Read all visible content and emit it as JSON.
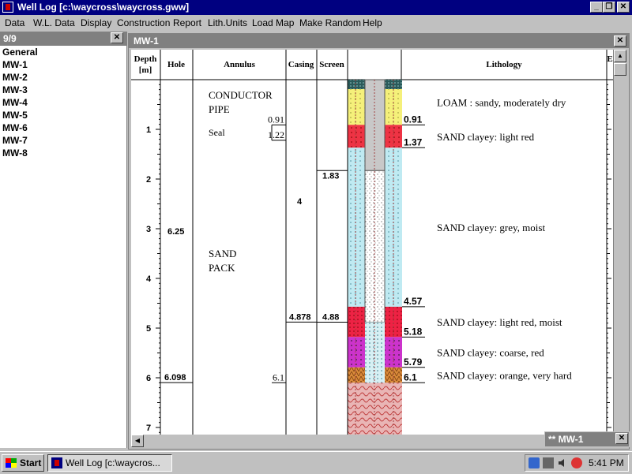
{
  "window": {
    "title": "Well Log [c:\\waycross\\waycross.gww]"
  },
  "menu": [
    "Data",
    "W.L. Data",
    "Display",
    "Construction",
    "Report",
    "Lith.Units",
    "Load Map",
    "Make Random",
    "Help"
  ],
  "left_panel": {
    "header": "9/9",
    "items": [
      "General",
      "MW-1",
      "MW-2",
      "MW-3",
      "MW-4",
      "MW-5",
      "MW-6",
      "MW-7",
      "MW-8"
    ]
  },
  "log_window": {
    "title": "MW-1",
    "columns": {
      "depth": "Depth [m]",
      "hole": "Hole",
      "annulus": "Annulus",
      "casing": "Casing",
      "screen": "Screen",
      "lithology": "Lithology",
      "extra": "E"
    },
    "depth_ticks": [
      "1",
      "2",
      "3",
      "4",
      "5",
      "6",
      "7"
    ],
    "hole": {
      "diameter": "6.25",
      "bottom": "6.098"
    },
    "annulus": {
      "conductor_line1": "CONDUCTOR",
      "conductor_line2": "PIPE",
      "conductor_bottom": "0.91",
      "seal_label": "Seal",
      "seal_bottom": "1.22",
      "sandpack_line1": "SAND",
      "sandpack_line2": "PACK",
      "bottom": "6.1"
    },
    "casing": {
      "diameter": "4",
      "bottom": "4.878"
    },
    "screen": {
      "top": "1.83",
      "bottom": "4.88"
    },
    "lithology": [
      {
        "top": 0.0,
        "bottom": 0.91,
        "depth_label": "0.91",
        "description": "LOAM : sandy, moderately dry",
        "color": "#f5f07a"
      },
      {
        "top": 0.91,
        "bottom": 1.37,
        "depth_label": "1.37",
        "description": "SAND clayey: light red",
        "color": "#ee3344"
      },
      {
        "top": 1.37,
        "bottom": 4.57,
        "depth_label": "4.57",
        "description": "SAND clayey: grey, moist",
        "color": "#bfeaf2"
      },
      {
        "top": 4.57,
        "bottom": 5.18,
        "depth_label": "5.18",
        "description": "SAND clayey: light red, moist",
        "color": "#ee2244"
      },
      {
        "top": 5.18,
        "bottom": 5.79,
        "depth_label": "5.79",
        "description": "SAND clayey: coarse, red",
        "color": "#cc33cc"
      },
      {
        "top": 5.79,
        "bottom": 6.1,
        "depth_label": "6.1",
        "description": "SAND clayey: orange, very hard",
        "color": "#d98a3a"
      }
    ]
  },
  "minimized_window": {
    "title": "** MW-1"
  },
  "taskbar": {
    "start": "Start",
    "task": "Well Log [c:\\waycros...",
    "clock": "5:41 PM"
  }
}
